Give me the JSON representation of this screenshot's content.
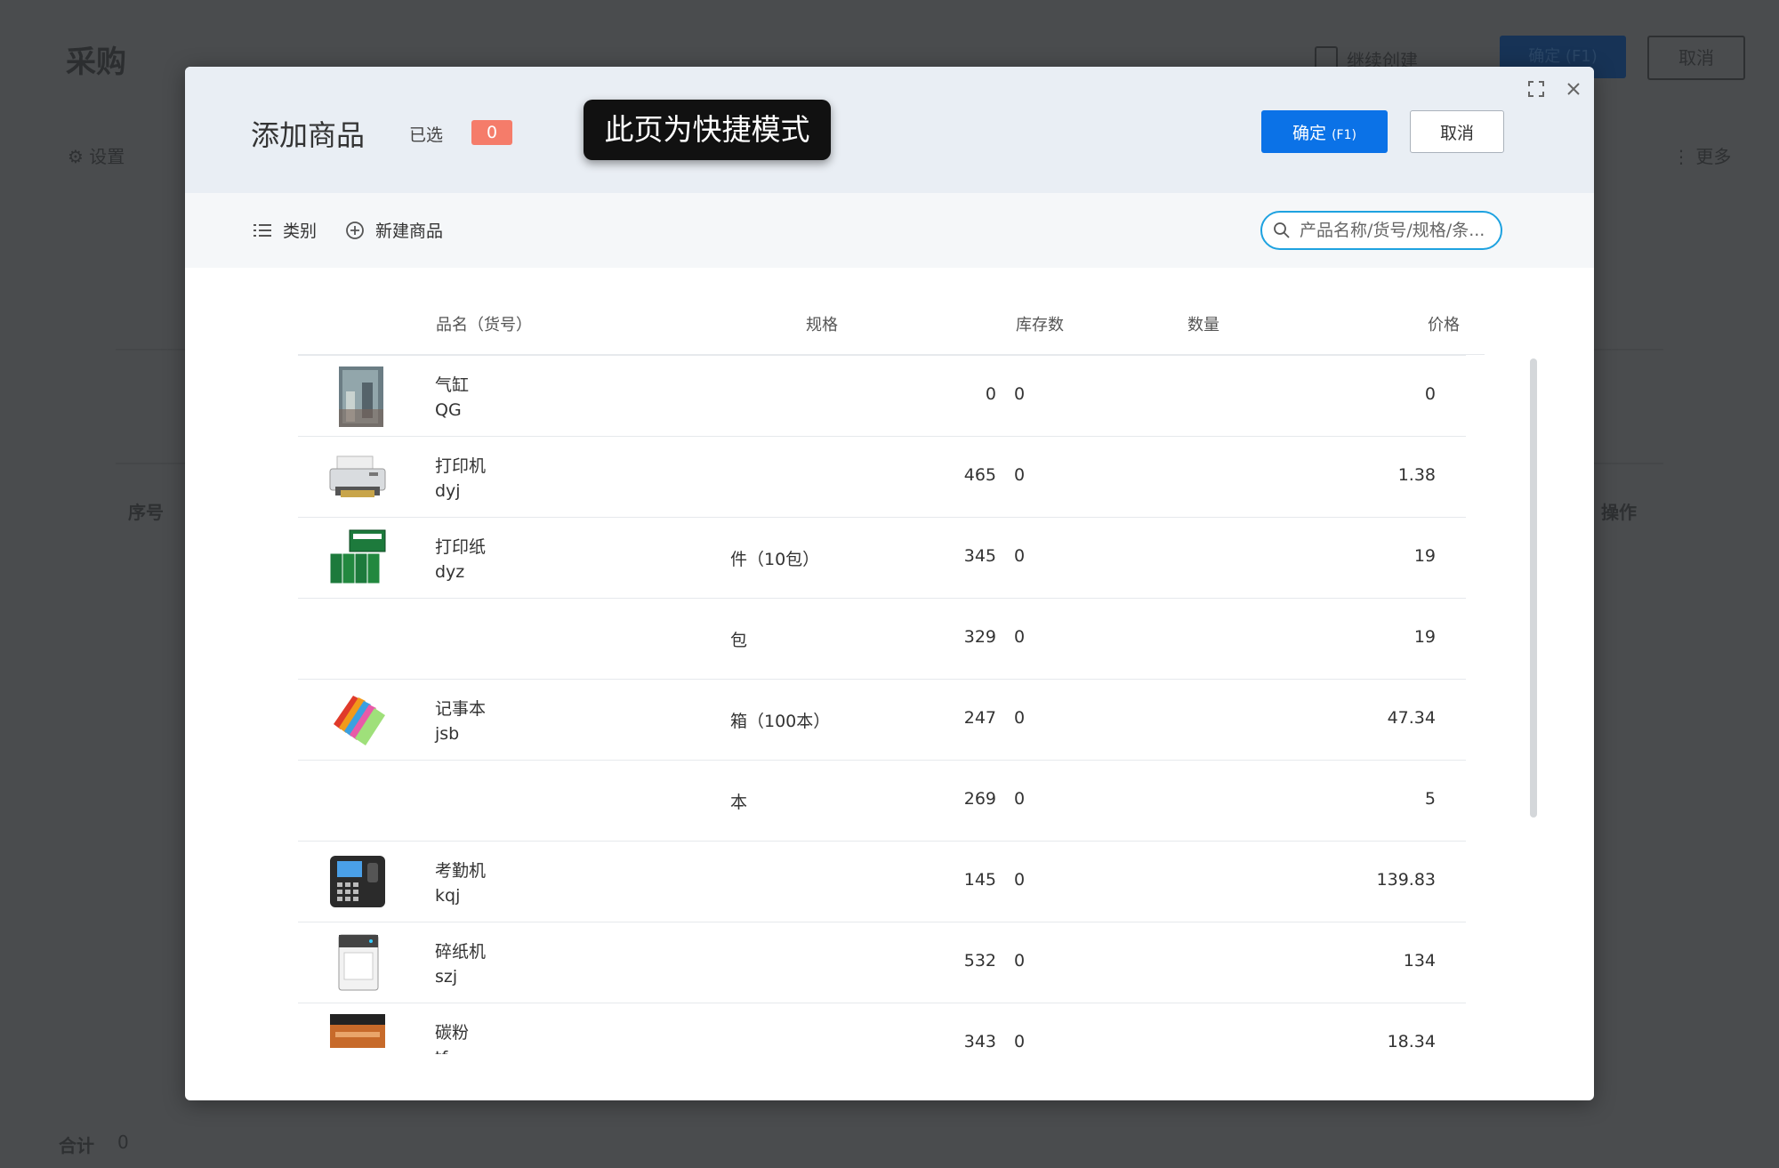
{
  "background": {
    "title": "采购",
    "quick_create": "继续创建",
    "confirm": "确定 (F1)",
    "cancel": "取消",
    "settings": "设置",
    "more": "更多",
    "col_no": "序号",
    "col_op": "操作",
    "total_label": "合计",
    "total_value": "0"
  },
  "modal": {
    "title": "添加商品",
    "selected_label": "已选",
    "selected_count": "0",
    "confirm_label": "确定",
    "confirm_hotkey": "(F1)",
    "cancel_label": "取消"
  },
  "toast": "此页为快捷模式",
  "toolbar": {
    "category": "类别",
    "new_product": "新建商品",
    "search_placeholder": "产品名称/货号/规格/条..."
  },
  "table": {
    "headers": {
      "name": "品名（货号）",
      "spec": "规格",
      "stock": "库存数",
      "qty": "数量",
      "price": "价格"
    },
    "rows": [
      {
        "name": "气缸",
        "code": "QG",
        "spec": "",
        "stock": "0",
        "qty": "0",
        "price": "0",
        "img": "cylinder"
      },
      {
        "name": "打印机",
        "code": "dyj",
        "spec": "",
        "stock": "465",
        "qty": "0",
        "price": "1.38",
        "img": "printer"
      },
      {
        "name": "打印纸",
        "code": "dyz",
        "spec": "件（10包）",
        "stock": "345",
        "qty": "0",
        "price": "19",
        "img": "paper"
      },
      {
        "name": "",
        "code": "",
        "spec": "包",
        "stock": "329",
        "qty": "0",
        "price": "19",
        "img": ""
      },
      {
        "name": "记事本",
        "code": "jsb",
        "spec": "箱（100本）",
        "stock": "247",
        "qty": "0",
        "price": "47.34",
        "img": "notebook"
      },
      {
        "name": "",
        "code": "",
        "spec": "本",
        "stock": "269",
        "qty": "0",
        "price": "5",
        "img": ""
      },
      {
        "name": "考勤机",
        "code": "kqj",
        "spec": "",
        "stock": "145",
        "qty": "0",
        "price": "139.83",
        "img": "attendance"
      },
      {
        "name": "碎纸机",
        "code": "szj",
        "spec": "",
        "stock": "532",
        "qty": "0",
        "price": "134",
        "img": "shredder"
      },
      {
        "name": "碳粉",
        "code": "tf",
        "spec": "",
        "stock": "343",
        "qty": "0",
        "price": "18.34",
        "img": "toner"
      }
    ]
  },
  "icons": {
    "expand": "expand-icon",
    "close": "close-icon",
    "list": "list-icon",
    "add": "add-circle-icon",
    "search": "search-icon"
  },
  "colors": {
    "primary": "#0b72e7",
    "badge": "#f57c6a",
    "search_border": "#1ea2e0",
    "header_bg": "#e9eef4"
  }
}
